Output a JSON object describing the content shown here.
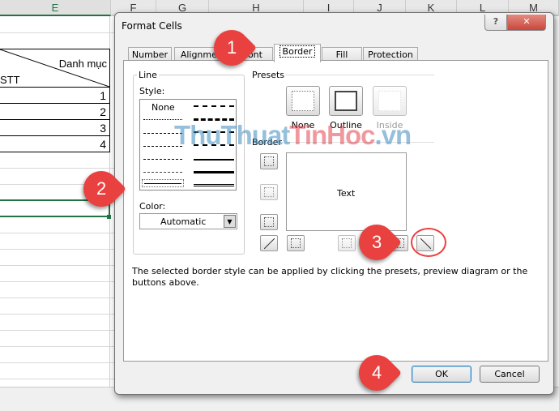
{
  "sheet": {
    "columns": [
      "E",
      "F",
      "G",
      "H",
      "I",
      "J",
      "K",
      "L",
      "M"
    ],
    "header_top": "Danh mục",
    "header_bottom": "STT",
    "rows": [
      "1",
      "2",
      "3",
      "4"
    ]
  },
  "dialog": {
    "title": "Format Cells",
    "help": "?",
    "close": "✕",
    "tabs": [
      {
        "label": "Number"
      },
      {
        "label": "Alignment"
      },
      {
        "label": "Font"
      },
      {
        "label": "Border",
        "active": true
      },
      {
        "label": "Fill"
      },
      {
        "label": "Protection"
      }
    ],
    "line": {
      "group": "Line",
      "style_label": "Style:",
      "none": "None",
      "color_label": "Color:",
      "color_value": "Automatic"
    },
    "presets": {
      "group": "Presets",
      "items": [
        "None",
        "Outline",
        "Inside"
      ]
    },
    "border": {
      "group": "Border",
      "preview_text": "Text"
    },
    "hint": "The selected border style can be applied by clicking the presets, preview diagram or the buttons above.",
    "ok": "OK",
    "cancel": "Cancel"
  },
  "watermark": "ThuThuatTinHoc.vn",
  "steps": [
    "1",
    "2",
    "3",
    "4"
  ],
  "colors": {
    "badge": "#e8413f",
    "excel_green": "#217346",
    "close": "#c9463d"
  }
}
